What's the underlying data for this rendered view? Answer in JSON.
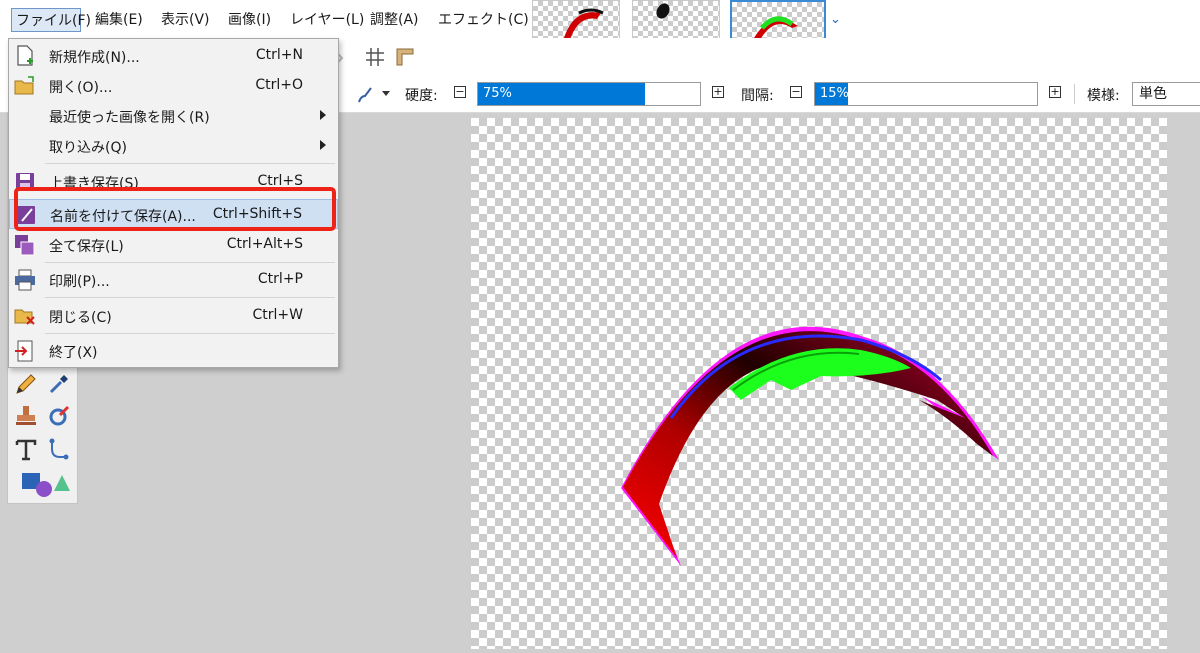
{
  "menubar": {
    "file": "ファイル(F)",
    "edit": "編集(E)",
    "view": "表示(V)",
    "image": "画像(I)",
    "layer": "レイヤー(L)",
    "adjust": "調整(A)",
    "effect": "エフェクト(C)"
  },
  "toolbar": {
    "hardness_label": "硬度:",
    "hardness_value": "75%",
    "hardness_fraction": 0.75,
    "spacing_label": "間隔:",
    "spacing_value": "15%",
    "spacing_fraction": 0.15,
    "pattern_label": "模様:",
    "pattern_value": "単色",
    "minus": "−",
    "plus": "+"
  },
  "file_menu": {
    "items": [
      {
        "label": "新規作成(N)...",
        "shortcut": "Ctrl+N",
        "icon": "new-file-icon"
      },
      {
        "label": "開く(O)...",
        "shortcut": "Ctrl+O",
        "icon": "open-folder-icon"
      },
      {
        "label": "最近使った画像を開く(R)",
        "shortcut": "",
        "icon": "",
        "submenu": true
      },
      {
        "label": "取り込み(Q)",
        "shortcut": "",
        "icon": "",
        "submenu": true
      },
      {
        "label": "上書き保存(S)",
        "shortcut": "Ctrl+S",
        "icon": "save-icon"
      },
      {
        "label": "名前を付けて保存(A)...",
        "shortcut": "Ctrl+Shift+S",
        "icon": "save-as-icon"
      },
      {
        "label": "全て保存(L)",
        "shortcut": "Ctrl+Alt+S",
        "icon": "save-all-icon"
      },
      {
        "label": "印刷(P)...",
        "shortcut": "Ctrl+P",
        "icon": "print-icon"
      },
      {
        "label": "閉じる(C)",
        "shortcut": "Ctrl+W",
        "icon": "close-folder-icon"
      },
      {
        "label": "終了(X)",
        "shortcut": "",
        "icon": "exit-icon"
      }
    ]
  },
  "colors": {
    "accent": "#0078d7",
    "highlight_box": "#ee2318",
    "stroke_green": "#1cff1c",
    "stroke_red": "#ff0000",
    "stroke_magenta": "#ff00ff",
    "stroke_blue": "#2a2aff"
  }
}
